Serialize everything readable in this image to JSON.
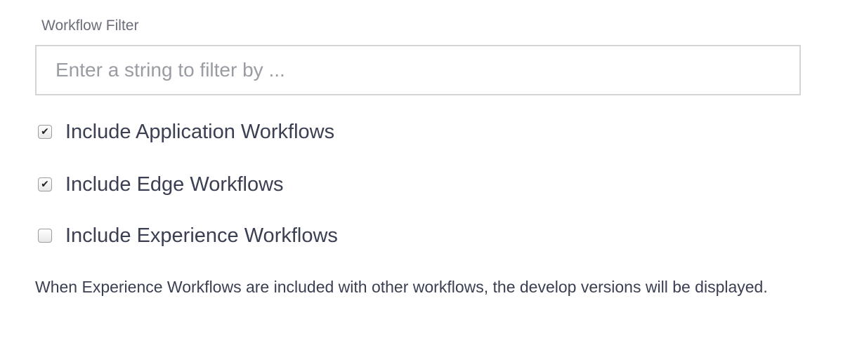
{
  "filter": {
    "label": "Workflow Filter",
    "placeholder": "Enter a string to filter by ...",
    "value": ""
  },
  "options": [
    {
      "label": "Include Application Workflows",
      "checked": true
    },
    {
      "label": "Include Edge Workflows",
      "checked": true
    },
    {
      "label": "Include Experience Workflows",
      "checked": false
    }
  ],
  "note": "When Experience Workflows are included with other workflows, the develop versions will be displayed."
}
